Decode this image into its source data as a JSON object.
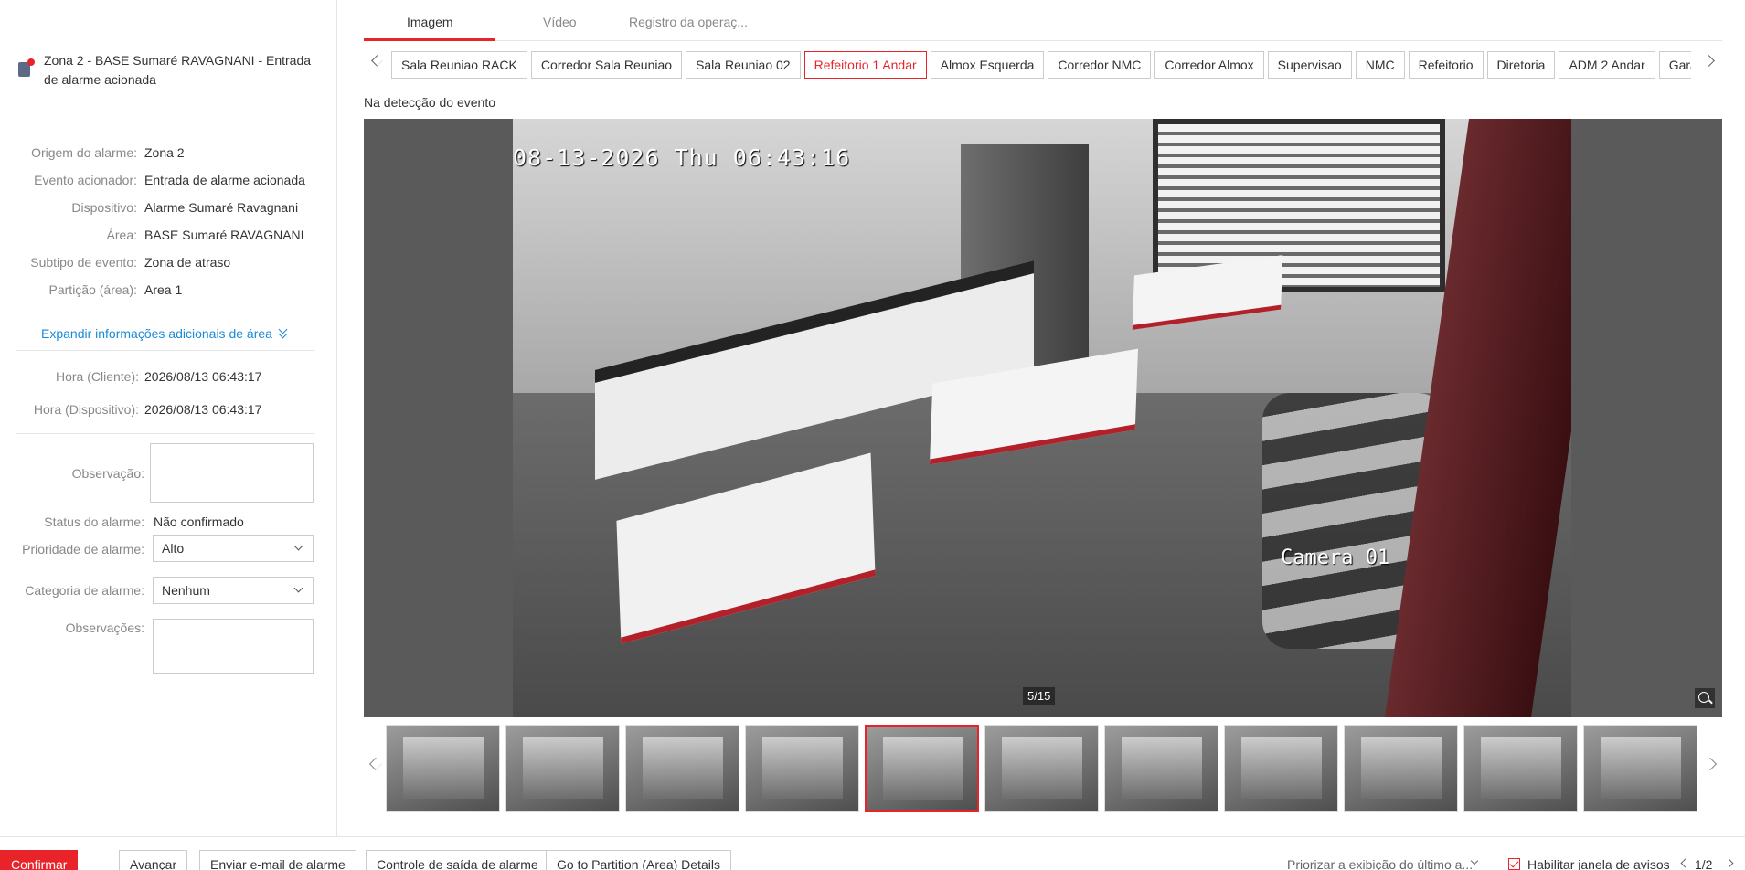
{
  "alarm": {
    "title": "Zona 2 - BASE Sumaré RAVAGNANI - Entrada de alarme acionada",
    "icon": "alarm-zone-icon"
  },
  "info": [
    {
      "label": "Origem do alarme:",
      "value": "Zona 2"
    },
    {
      "label": "Evento acionador:",
      "value": "Entrada de alarme acionada"
    },
    {
      "label": "Dispositivo:",
      "value": "Alarme Sumaré Ravagnani"
    },
    {
      "label": "Área:",
      "value": "BASE Sumaré RAVAGNANI"
    },
    {
      "label": "Subtipo de evento:",
      "value": "Zona de atraso"
    },
    {
      "label": "Partição (área):",
      "value": "Area 1"
    }
  ],
  "expand_label": "Expandir informações adicionais de área",
  "times": [
    {
      "label": "Hora (Cliente):",
      "value": "2026/08/13 06:43:17"
    },
    {
      "label": "Hora (Dispositivo):",
      "value": "2026/08/13 06:43:17"
    }
  ],
  "form": {
    "observacao_label": "Observação:",
    "status_label": "Status do alarme:",
    "status_value": "Não confirmado",
    "priority_label": "Prioridade de alarme:",
    "priority_value": "Alto",
    "category_label": "Categoria de alarme:",
    "category_value": "Nenhum",
    "observacoes_label": "Observações:"
  },
  "tabs": [
    "Imagem",
    "Vídeo",
    "Registro da operaç..."
  ],
  "cameras": [
    "Sala Reuniao RACK",
    "Corredor Sala Reuniao",
    "Sala Reuniao 02",
    "Refeitorio 1 Andar",
    "Almox Esquerda",
    "Corredor NMC",
    "Corredor Almox",
    "Supervisao",
    "NMC",
    "Refeitorio",
    "Diretoria",
    "ADM 2 Andar",
    "Garaq"
  ],
  "active_camera": 3,
  "detection_label": "Na detecção do evento",
  "viewer": {
    "osd_time": "08-13-2026 Thu 06:43:16",
    "osd_camera": "Camera 01",
    "counter": "5/15"
  },
  "thumbnails": {
    "count": 11,
    "active": 4
  },
  "bottom": {
    "confirm": "Confirmar",
    "advance": "Avançar",
    "email": "Enviar e-mail de alarme",
    "output": "Controle de saída de alarme",
    "partition": "Go to Partition (Area) Details",
    "priority_option": "Priorizar a exibição do último a...",
    "checkbox_label": "Habilitar janela de avisos",
    "pager": "1/2"
  },
  "colors": {
    "accent": "#e8242a",
    "link": "#1a8ad8"
  }
}
